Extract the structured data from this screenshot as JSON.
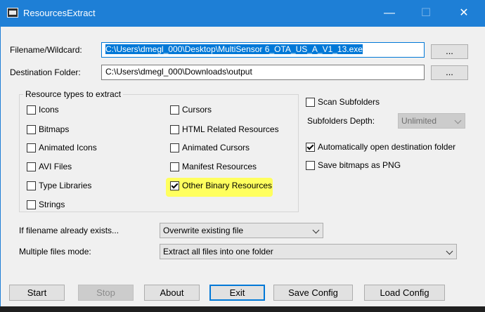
{
  "window": {
    "title": "ResourcesExtract",
    "minimize_glyph": "—",
    "maximize_glyph": "☐",
    "close_glyph": "✕"
  },
  "filename": {
    "label": "Filename/Wildcard:",
    "value": "C:\\Users\\dmegl_000\\Desktop\\MultiSensor 6_OTA_US_A_V1_13.exe",
    "browse_label": "..."
  },
  "destination": {
    "label": "Destination Folder:",
    "value": "C:\\Users\\dmegl_000\\Downloads\\output",
    "browse_label": "..."
  },
  "resource_types": {
    "title": "Resource types to extract",
    "items": [
      {
        "label": "Icons",
        "checked": false
      },
      {
        "label": "Bitmaps",
        "checked": false
      },
      {
        "label": "Animated Icons",
        "checked": false
      },
      {
        "label": "AVI Files",
        "checked": false
      },
      {
        "label": "Type Libraries",
        "checked": false
      },
      {
        "label": "Strings",
        "checked": false
      },
      {
        "label": "Cursors",
        "checked": false
      },
      {
        "label": "HTML Related Resources",
        "checked": false
      },
      {
        "label": "Animated Cursors",
        "checked": false
      },
      {
        "label": "Manifest Resources",
        "checked": false
      },
      {
        "label": "Other Binary Resources",
        "checked": true
      }
    ]
  },
  "options": {
    "scan_subfolders": {
      "label": "Scan Subfolders",
      "checked": false
    },
    "subfolders_depth": {
      "label": "Subfolders Depth:",
      "value": "Unlimited"
    },
    "auto_open": {
      "label": "Automatically open destination folder",
      "checked": true
    },
    "save_png": {
      "label": "Save bitmaps as PNG",
      "checked": false
    }
  },
  "if_exists": {
    "label": "If filename already exists...",
    "value": "Overwrite existing file"
  },
  "multiple_files": {
    "label": "Multiple files mode:",
    "value": "Extract all files into one folder"
  },
  "buttons": {
    "start": "Start",
    "stop": "Stop",
    "about": "About",
    "exit": "Exit",
    "save_config": "Save Config",
    "load_config": "Load Config"
  },
  "colors": {
    "titlebar": "#1e7fd6",
    "selection": "#0078d7",
    "highlight": "#ffff55"
  }
}
